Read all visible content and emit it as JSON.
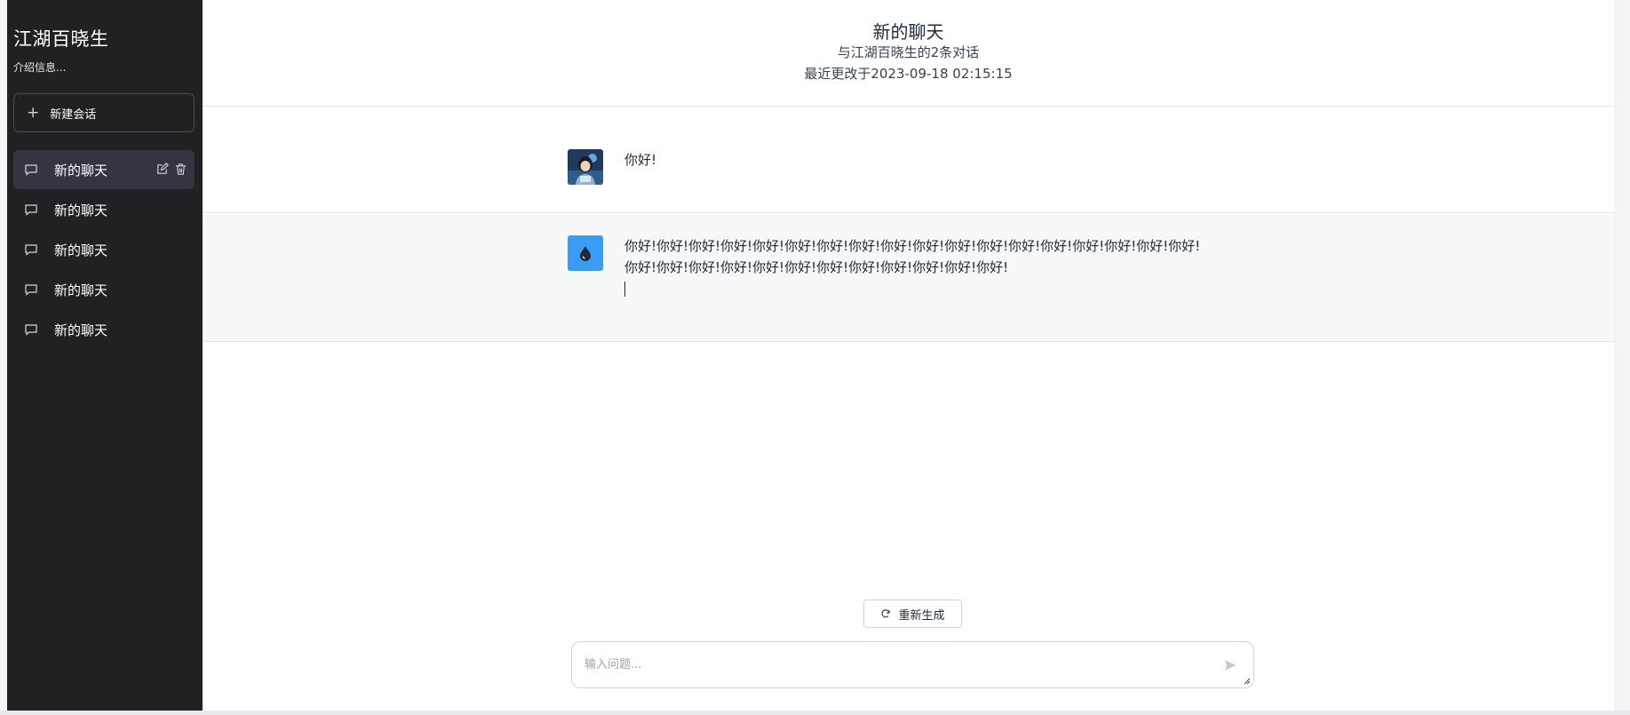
{
  "sidebar": {
    "title": "江湖百晓生",
    "intro": "介绍信息...",
    "new_chat_label": "新建会话",
    "conversations": [
      {
        "label": "新的聊天",
        "active": true
      },
      {
        "label": "新的聊天",
        "active": false
      },
      {
        "label": "新的聊天",
        "active": false
      },
      {
        "label": "新的聊天",
        "active": false
      },
      {
        "label": "新的聊天",
        "active": false
      }
    ]
  },
  "header": {
    "title": "新的聊天",
    "subtitle": "与江湖百晓生的2条对话",
    "updated": "最近更改于2023-09-18 02:15:15"
  },
  "messages": [
    {
      "role": "user",
      "text": "你好!"
    },
    {
      "role": "assistant",
      "text": "你好!你好!你好!你好!你好!你好!你好!你好!你好!你好!你好!你好!你好!你好!你好!你好!你好!你好!你好!你好!你好!你好!你好!你好!你好!你好!你好!你好!你好!你好!"
    }
  ],
  "actions": {
    "regenerate_label": "重新生成"
  },
  "input": {
    "value": "",
    "placeholder": "输入问题..."
  },
  "icons": {
    "new_chat": "plus-icon",
    "conversation": "chat-bubble-icon",
    "edit": "edit-icon",
    "delete": "trash-icon",
    "regenerate": "refresh-icon",
    "send": "send-icon",
    "bot_avatar": "water-drop-icon",
    "user_avatar": "user-avatar-image"
  },
  "colors": {
    "sidebar_bg": "#202123",
    "active_item_bg": "#343541",
    "bot_avatar_bg": "#3b9cf5",
    "assistant_row_bg": "#f7f8fa"
  }
}
